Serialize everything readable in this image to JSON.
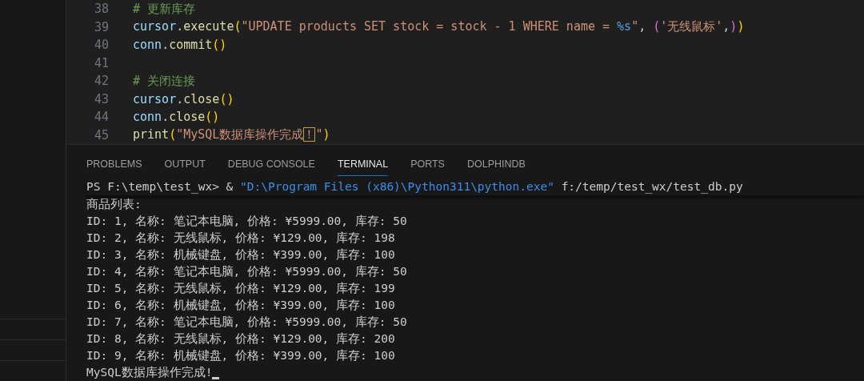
{
  "editor": {
    "lines": [
      {
        "number": "38",
        "tokens": [
          {
            "kind": "comment",
            "text": "# 更新库存"
          }
        ]
      },
      {
        "number": "39",
        "tokens": [
          {
            "kind": "var",
            "text": "cursor"
          },
          {
            "kind": "punct",
            "text": "."
          },
          {
            "kind": "func",
            "text": "execute"
          },
          {
            "kind": "bracket1",
            "text": "("
          },
          {
            "kind": "string",
            "text": "\"UPDATE products SET stock = stock - 1 WHERE name = "
          },
          {
            "kind": "format",
            "text": "%s"
          },
          {
            "kind": "string",
            "text": "\""
          },
          {
            "kind": "punct",
            "text": ", "
          },
          {
            "kind": "bracket2",
            "text": "("
          },
          {
            "kind": "string",
            "text": "'无线鼠标'"
          },
          {
            "kind": "punct",
            "text": ","
          },
          {
            "kind": "bracket2",
            "text": ")"
          },
          {
            "kind": "bracket1",
            "text": ")"
          }
        ]
      },
      {
        "number": "40",
        "tokens": [
          {
            "kind": "var",
            "text": "conn"
          },
          {
            "kind": "punct",
            "text": "."
          },
          {
            "kind": "func",
            "text": "commit"
          },
          {
            "kind": "bracket1",
            "text": "()"
          }
        ]
      },
      {
        "number": "41"
      },
      {
        "number": "42",
        "tokens": [
          {
            "kind": "comment",
            "text": "# 关闭连接"
          }
        ]
      },
      {
        "number": "43",
        "tokens": [
          {
            "kind": "var",
            "text": "cursor"
          },
          {
            "kind": "punct",
            "text": "."
          },
          {
            "kind": "func",
            "text": "close"
          },
          {
            "kind": "bracket1",
            "text": "()"
          }
        ]
      },
      {
        "number": "44",
        "tokens": [
          {
            "kind": "var",
            "text": "conn"
          },
          {
            "kind": "punct",
            "text": "."
          },
          {
            "kind": "func",
            "text": "close"
          },
          {
            "kind": "bracket1",
            "text": "()"
          }
        ]
      },
      {
        "number": "45",
        "tokens": [
          {
            "kind": "func",
            "text": "print"
          },
          {
            "kind": "bracket1",
            "text": "("
          },
          {
            "kind": "string",
            "text": "\"MySQL数据库操作完成"
          },
          {
            "kind": "highlight",
            "text": "！"
          },
          {
            "kind": "string",
            "text": "\""
          },
          {
            "kind": "bracket1",
            "text": ")"
          }
        ]
      }
    ]
  },
  "panel": {
    "tabs": [
      {
        "label": "PROBLEMS",
        "selected": false
      },
      {
        "label": "OUTPUT",
        "selected": false
      },
      {
        "label": "DEBUG CONSOLE",
        "selected": false
      },
      {
        "label": "TERMINAL",
        "selected": true
      },
      {
        "label": "PORTS",
        "selected": false
      },
      {
        "label": "DOLPHINDB",
        "selected": false
      }
    ],
    "terminal": {
      "command_tokens": [
        {
          "kind": "plain",
          "text": "PS F:\\temp\\test_wx> & "
        },
        {
          "kind": "path",
          "text": "\"D:\\Program Files (x86)\\Python311\\python.exe\""
        },
        {
          "kind": "plain",
          "text": " f:/temp/test_wx/test_db.py"
        }
      ],
      "output": [
        "商品列表:",
        "ID: 1, 名称: 笔记本电脑, 价格: ¥5999.00, 库存: 50",
        "ID: 2, 名称: 无线鼠标, 价格: ¥129.00, 库存: 198",
        "ID: 3, 名称: 机械键盘, 价格: ¥399.00, 库存: 100",
        "ID: 4, 名称: 笔记本电脑, 价格: ¥5999.00, 库存: 50",
        "ID: 5, 名称: 无线鼠标, 价格: ¥129.00, 库存: 199",
        "ID: 6, 名称: 机械键盘, 价格: ¥399.00, 库存: 100",
        "ID: 7, 名称: 笔记本电脑, 价格: ¥5999.00, 库存: 50",
        "ID: 8, 名称: 无线鼠标, 价格: ¥129.00, 库存: 200",
        "ID: 9, 名称: 机械键盘, 价格: ¥399.00, 库存: 100",
        "MySQL数据库操作完成!"
      ]
    }
  }
}
